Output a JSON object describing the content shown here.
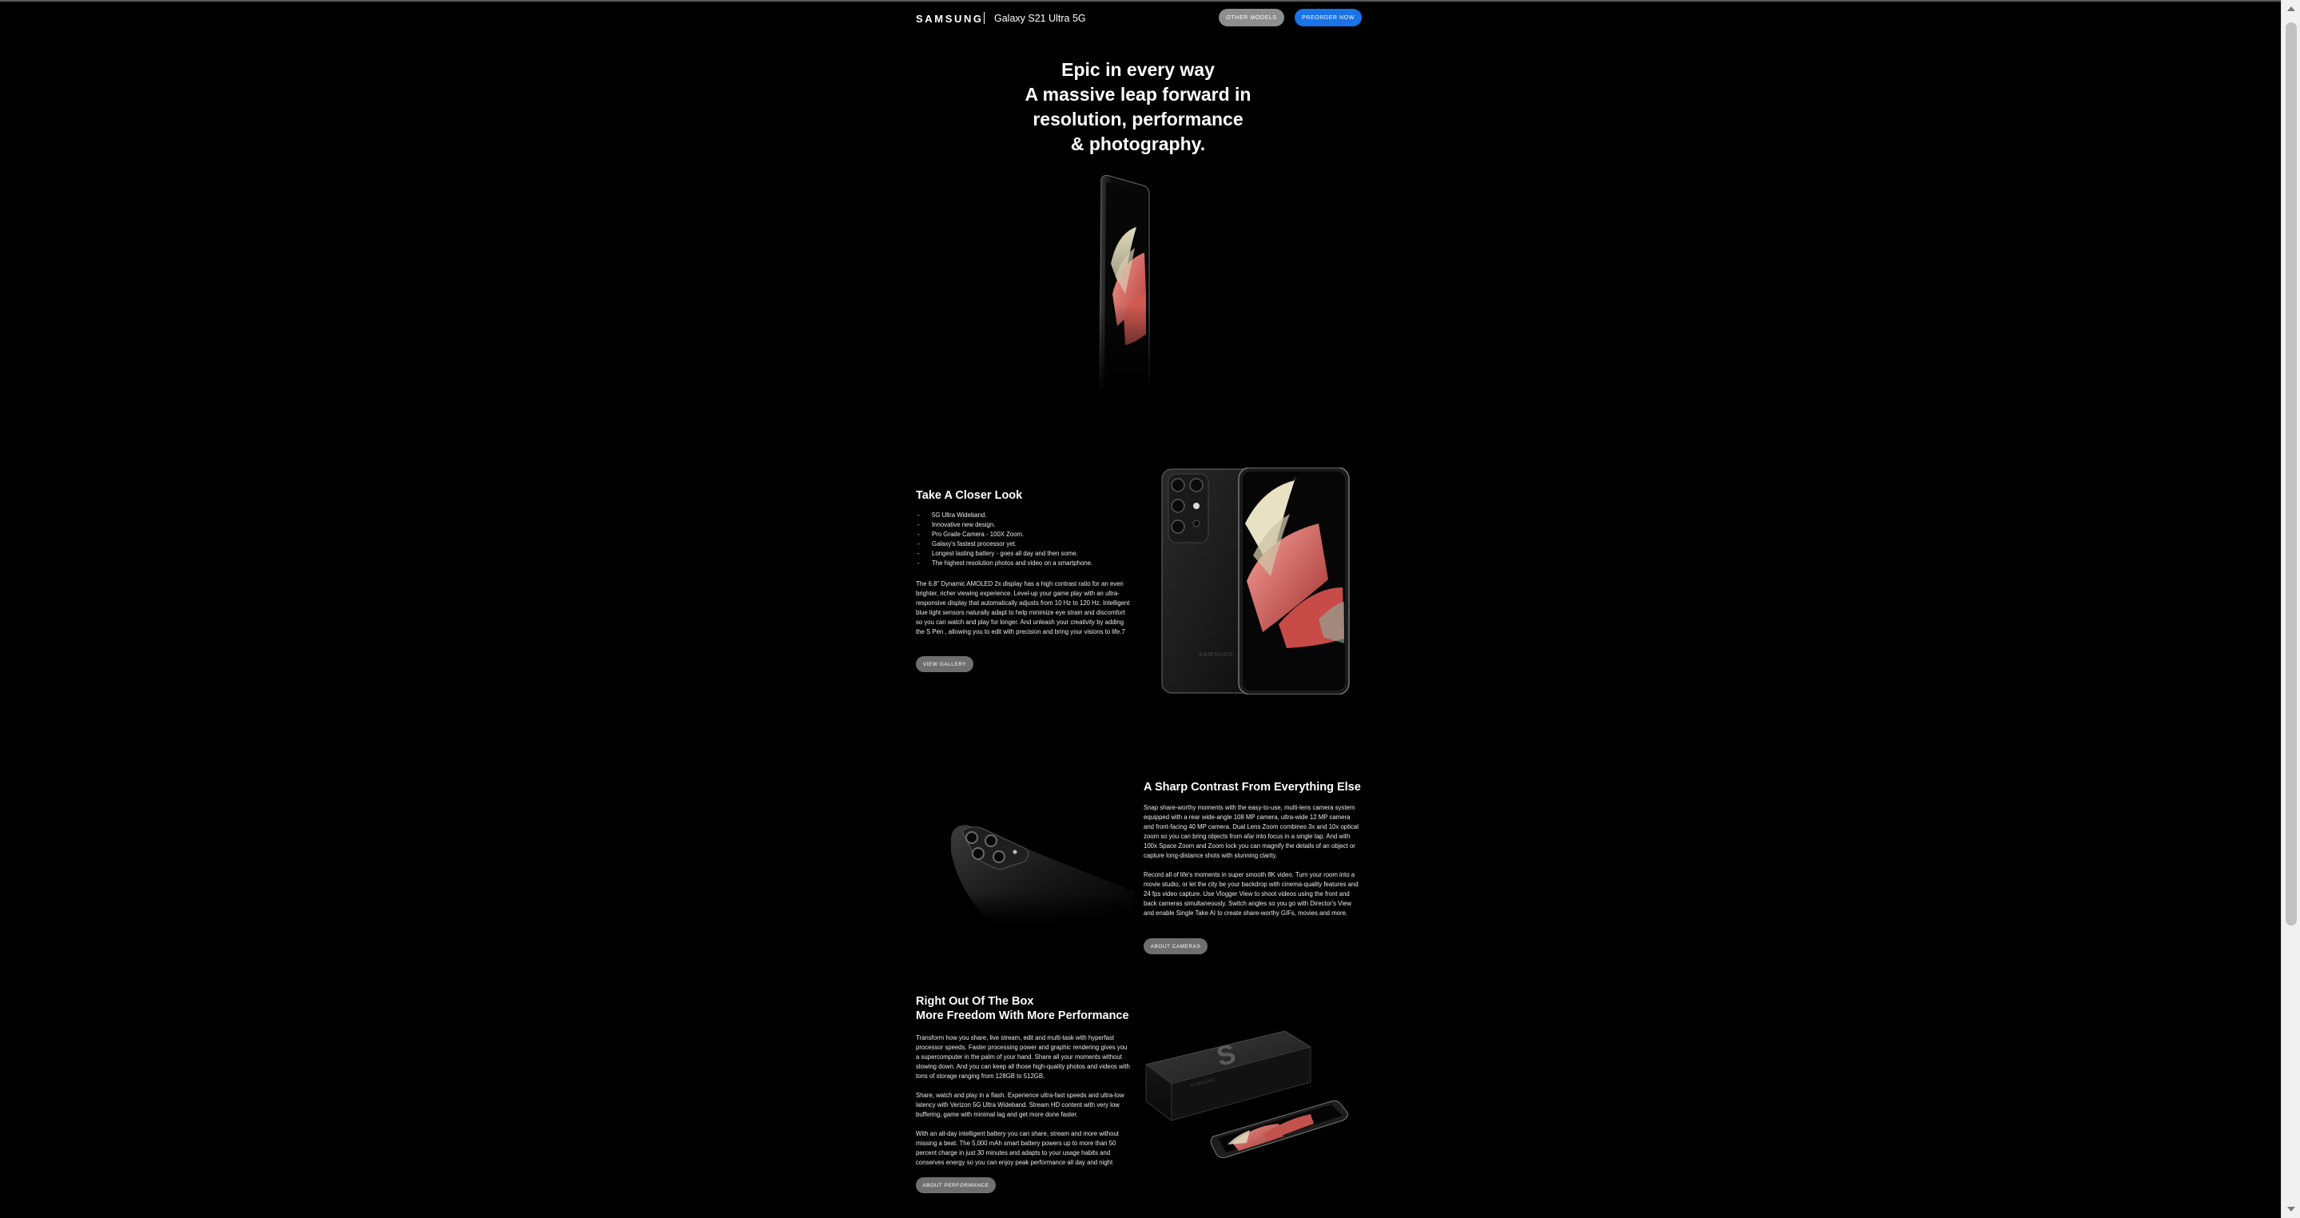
{
  "header": {
    "brand": "SAMSUNG",
    "model": "Galaxy S21 Ultra 5G",
    "other_models": "OTHER MODELS",
    "preorder": "PREORDER NOW"
  },
  "hero": {
    "lines": [
      "Epic in every way",
      "A massive leap forward in",
      "resolution, performance",
      "& photography."
    ]
  },
  "closer_look": {
    "title": "Take A Closer Look",
    "bullets": [
      "5G Ultra Wideband.",
      "Innovative new design.",
      "Pro Grade Camera - 100X Zoom.",
      "Galaxy's fastest processor yet.",
      "Longest lasting battery - goes all day and then some.",
      "The highest resolution photos and video on a smartphone."
    ],
    "body": "The 6.8\" Dynamic AMOLED 2x display has a high contrast ratio for an even brighter, richer viewing experience. Level-up your game play with an ultra-responsive display that automatically adjusts from 10 Hz to 120 Hz. Intelligent blue light sensors naturally adapt to help minimize eye strain and discomfort so you can watch and play for longer. And unleash your creativity by adding the S Pen , allowing you to edit with precision and bring your visions to life.7",
    "button": "VIEW GALLERY"
  },
  "contrast": {
    "title": "A Sharp Contrast From Everything Else",
    "body1": "Snap share-worthy moments with the easy-to-use, multi-lens camera system equipped with a rear wide-angle 108 MP camera, ultra-wide 12 MP camera and front-facing 40 MP camera. Dual Lens Zoom combines 3x and 10x optical zoom so you can bring objects from afar into focus in a single tap. And with 100x Space Zoom and Zoom lock you can magnify the details of an object or capture long-distance shots with stunning clarity.",
    "body2": "Record all of life's moments in super smooth 8K video. Turn your room into a movie studio, or let the city be your backdrop with cinema-quality features and 24 fps video capture. Use Vlogger View to shoot videos using the front and back cameras simultaneously. Switch angles so you go with Director's View and enable Single Take AI to create share-worthy GIFs, movies and more.",
    "button": "ABOUT CAMERAS"
  },
  "performance": {
    "title_line1": "Right Out Of The Box",
    "title_line2": "More Freedom With More Performance",
    "body1": "Transform how you share, live stream, edit and multi-task with hyperfast processor speeds. Faster processing power and graphic rendering gives you a supercomputer in the palm of your hand. Share all your moments without slowing down. And you can keep all those high-quality photos and videos with tons of storage ranging from 128GB to 512GB.",
    "body2": "Share, watch and play in a flash. Experience ultra-fast speeds and ultra-low latency with Verizon 5G Ultra Wideband. Stream HD content with very low buffering, game with minimal lag and get more done faster.",
    "body3": "With an all-day intelligent battery you can share, stream and more without missing a beat. The 5,000 mAh smart battery powers up to more than 50 percent charge in just 30 minutes and adapts to your usage habits and conserves energy so you can enjoy peak performance all day and night",
    "button": "ABOUT PERFORMANCE",
    "box_brand": "SAMSUNG"
  }
}
